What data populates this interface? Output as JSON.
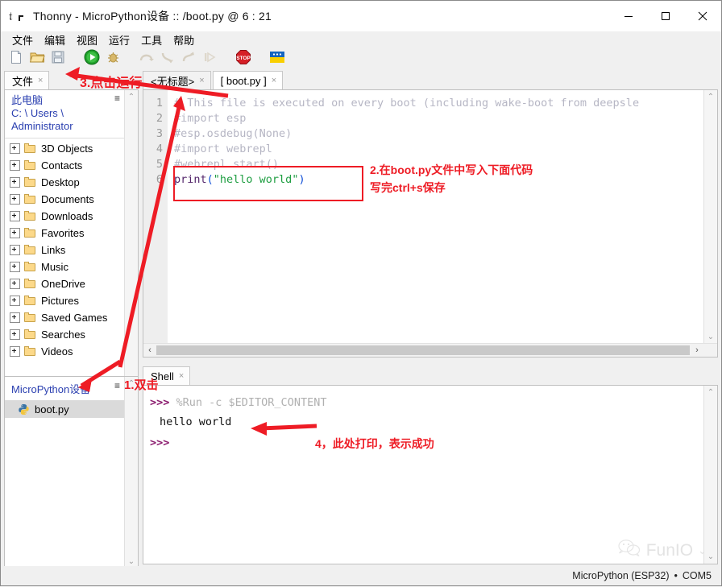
{
  "window": {
    "title": "Thonny  -  MicroPython设备 :: /boot.py  @  6 : 21",
    "app_icon": "thonny-icon",
    "minimize_label": "—",
    "maximize_label": "□",
    "close_label": "✕"
  },
  "menu": {
    "items": [
      {
        "label": "文件",
        "name": "menu-file"
      },
      {
        "label": "编辑",
        "name": "menu-edit"
      },
      {
        "label": "视图",
        "name": "menu-view"
      },
      {
        "label": "运行",
        "name": "menu-run"
      },
      {
        "label": "工具",
        "name": "menu-tools"
      },
      {
        "label": "帮助",
        "name": "menu-help"
      }
    ]
  },
  "toolbar": {
    "buttons": [
      {
        "name": "new-file-icon",
        "title": "新建"
      },
      {
        "name": "open-folder-icon",
        "title": "打开"
      },
      {
        "name": "save-icon",
        "title": "保存"
      },
      {
        "name": "run-icon",
        "title": "运行"
      },
      {
        "name": "debug-icon",
        "title": "调试"
      },
      {
        "name": "step-over-icon",
        "title": "单步跳过"
      },
      {
        "name": "step-into-icon",
        "title": "单步进入"
      },
      {
        "name": "step-out-icon",
        "title": "单步跳出"
      },
      {
        "name": "resume-icon",
        "title": "继续"
      },
      {
        "name": "stop-icon",
        "title": "停止"
      },
      {
        "name": "support-flag-icon",
        "title": "支持"
      }
    ]
  },
  "files_panel": {
    "tab": {
      "label": "文件",
      "close": "×"
    },
    "path_line1": "此电脑",
    "path_line2": "C: \\ Users \\",
    "path_line3": "Administrator",
    "menu_icon": "≡",
    "scroll_up": "⌃",
    "scroll_down": "⌄",
    "tree": [
      {
        "label": "3D Objects"
      },
      {
        "label": "Contacts"
      },
      {
        "label": "Desktop"
      },
      {
        "label": "Documents"
      },
      {
        "label": "Downloads"
      },
      {
        "label": "Favorites"
      },
      {
        "label": "Links"
      },
      {
        "label": "Music"
      },
      {
        "label": "OneDrive"
      },
      {
        "label": "Pictures"
      },
      {
        "label": "Saved Games"
      },
      {
        "label": "Searches"
      },
      {
        "label": "Videos"
      }
    ]
  },
  "device_panel": {
    "title": "MicroPython设备",
    "menu_icon": "≡",
    "files": [
      {
        "label": "boot.py",
        "icon": "python-file-icon",
        "selected": true
      }
    ],
    "scroll_up": "⌃",
    "scroll_down": "⌄"
  },
  "editor": {
    "tabs": [
      {
        "label": "<无标题>",
        "close": "×",
        "active": false,
        "name": "tab-untitled"
      },
      {
        "label": "[ boot.py ]",
        "close": "×",
        "active": true,
        "name": "tab-boot-py"
      }
    ],
    "lines": [
      {
        "num": "1",
        "text": "# This file is executed on every boot (including wake-boot from deepsle",
        "kind": "comment"
      },
      {
        "num": "2",
        "text": "#import esp",
        "kind": "comment"
      },
      {
        "num": "3",
        "text": "#esp.osdebug(None)",
        "kind": "comment"
      },
      {
        "num": "4",
        "text": "#import webrepl",
        "kind": "comment"
      },
      {
        "num": "5",
        "text": "#webrepl.start()",
        "kind": "comment"
      },
      {
        "num": "6",
        "text": "print(\"hello world\")",
        "kind": "code"
      }
    ],
    "code_line6": {
      "fn": "print",
      "open_paren": "(",
      "string": "\"hello world\"",
      "close_paren": ")"
    },
    "hscroll": {
      "left": "‹",
      "right": "›"
    },
    "vscroll": {
      "up": "⌃",
      "down": "⌄"
    }
  },
  "shell": {
    "tab": {
      "label": "Shell",
      "close": "×"
    },
    "lines": [
      {
        "prompt": ">>>",
        "text": " %Run -c $EDITOR_CONTENT",
        "type": "command"
      },
      {
        "prompt": "",
        "text": "hello world",
        "type": "output"
      },
      {
        "prompt": ">>>",
        "text": "",
        "type": "command"
      }
    ],
    "vscroll": {
      "up": "⌃",
      "down": "⌄"
    }
  },
  "statusbar": {
    "interpreter": "MicroPython (ESP32)",
    "separator": "•",
    "port": "COM5"
  },
  "watermark": {
    "text": "FunIO",
    "icon": "wechat-icon",
    "chevron": "⌄"
  },
  "annotations": [
    {
      "name": "annotation-1",
      "text": "1.双击"
    },
    {
      "name": "annotation-2",
      "text": "2.在boot.py文件中写入下面代码\n写完ctrl+s保存"
    },
    {
      "name": "annotation-3",
      "text": "3.点击运行"
    },
    {
      "name": "annotation-4",
      "text": "4，此处打印，表示成功"
    }
  ],
  "colors": {
    "annotation_red": "#ee1c25",
    "link_blue": "#2a3fb0",
    "comment_grey": "#b6b6c4",
    "string_green": "#1f9e42",
    "prompt_magenta": "#8b1b6e"
  }
}
